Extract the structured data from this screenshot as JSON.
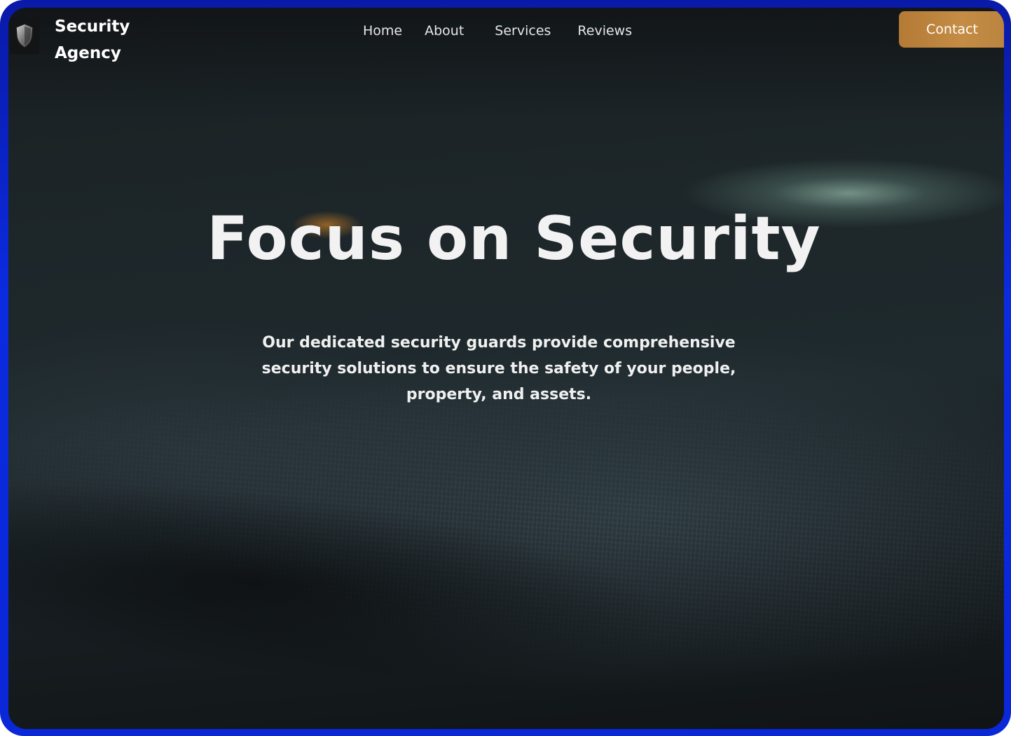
{
  "brand": {
    "line1": "Security",
    "line2": "Agency",
    "logo_icon": "shield-icon"
  },
  "nav": {
    "items": [
      {
        "label": "Home"
      },
      {
        "label": "About"
      },
      {
        "label": "Services"
      },
      {
        "label": "Reviews"
      }
    ],
    "contact_label": "Contact"
  },
  "hero": {
    "title": "Focus on Security",
    "subtitle": "Our dedicated security guards provide comprehensive security solutions to ensure the safety of your people, property, and assets."
  },
  "colors": {
    "frame": "#0b2be0",
    "contact_button": "#c48c44",
    "text": "#f2f2f2"
  }
}
